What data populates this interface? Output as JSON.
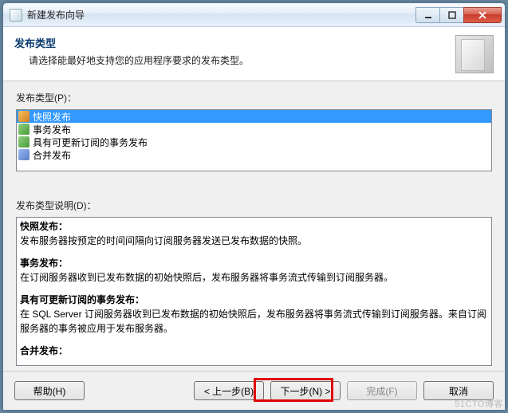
{
  "window": {
    "title": "新建发布向导"
  },
  "header": {
    "title": "发布类型",
    "subtitle": "请选择能最好地支持您的应用程序要求的发布类型。"
  },
  "type_list": {
    "label": "发布类型(P)：",
    "items": [
      {
        "label": "快照发布",
        "selected": true
      },
      {
        "label": "事务发布",
        "selected": false
      },
      {
        "label": "具有可更新订阅的事务发布",
        "selected": false
      },
      {
        "label": "合并发布",
        "selected": false
      }
    ]
  },
  "description": {
    "label": "发布类型说明(D)：",
    "sections": [
      {
        "title": "快照发布：",
        "body": "发布服务器按预定的时间间隔向订阅服务器发送已发布数据的快照。"
      },
      {
        "title": "事务发布：",
        "body": "在订阅服务器收到已发布数据的初始快照后，发布服务器将事务流式传输到订阅服务器。"
      },
      {
        "title": "具有可更新订阅的事务发布：",
        "body": "在 SQL Server 订阅服务器收到已发布数据的初始快照后，发布服务器将事务流式传输到订阅服务器。来自订阅服务器的事务被应用于发布服务器。"
      },
      {
        "title": "合并发布：",
        "body": ""
      }
    ]
  },
  "buttons": {
    "help": "帮助(H)",
    "back": "< 上一步(B)",
    "next": "下一步(N) >",
    "finish": "完成(F)",
    "cancel": "取消"
  },
  "watermark": "51CTO博客"
}
